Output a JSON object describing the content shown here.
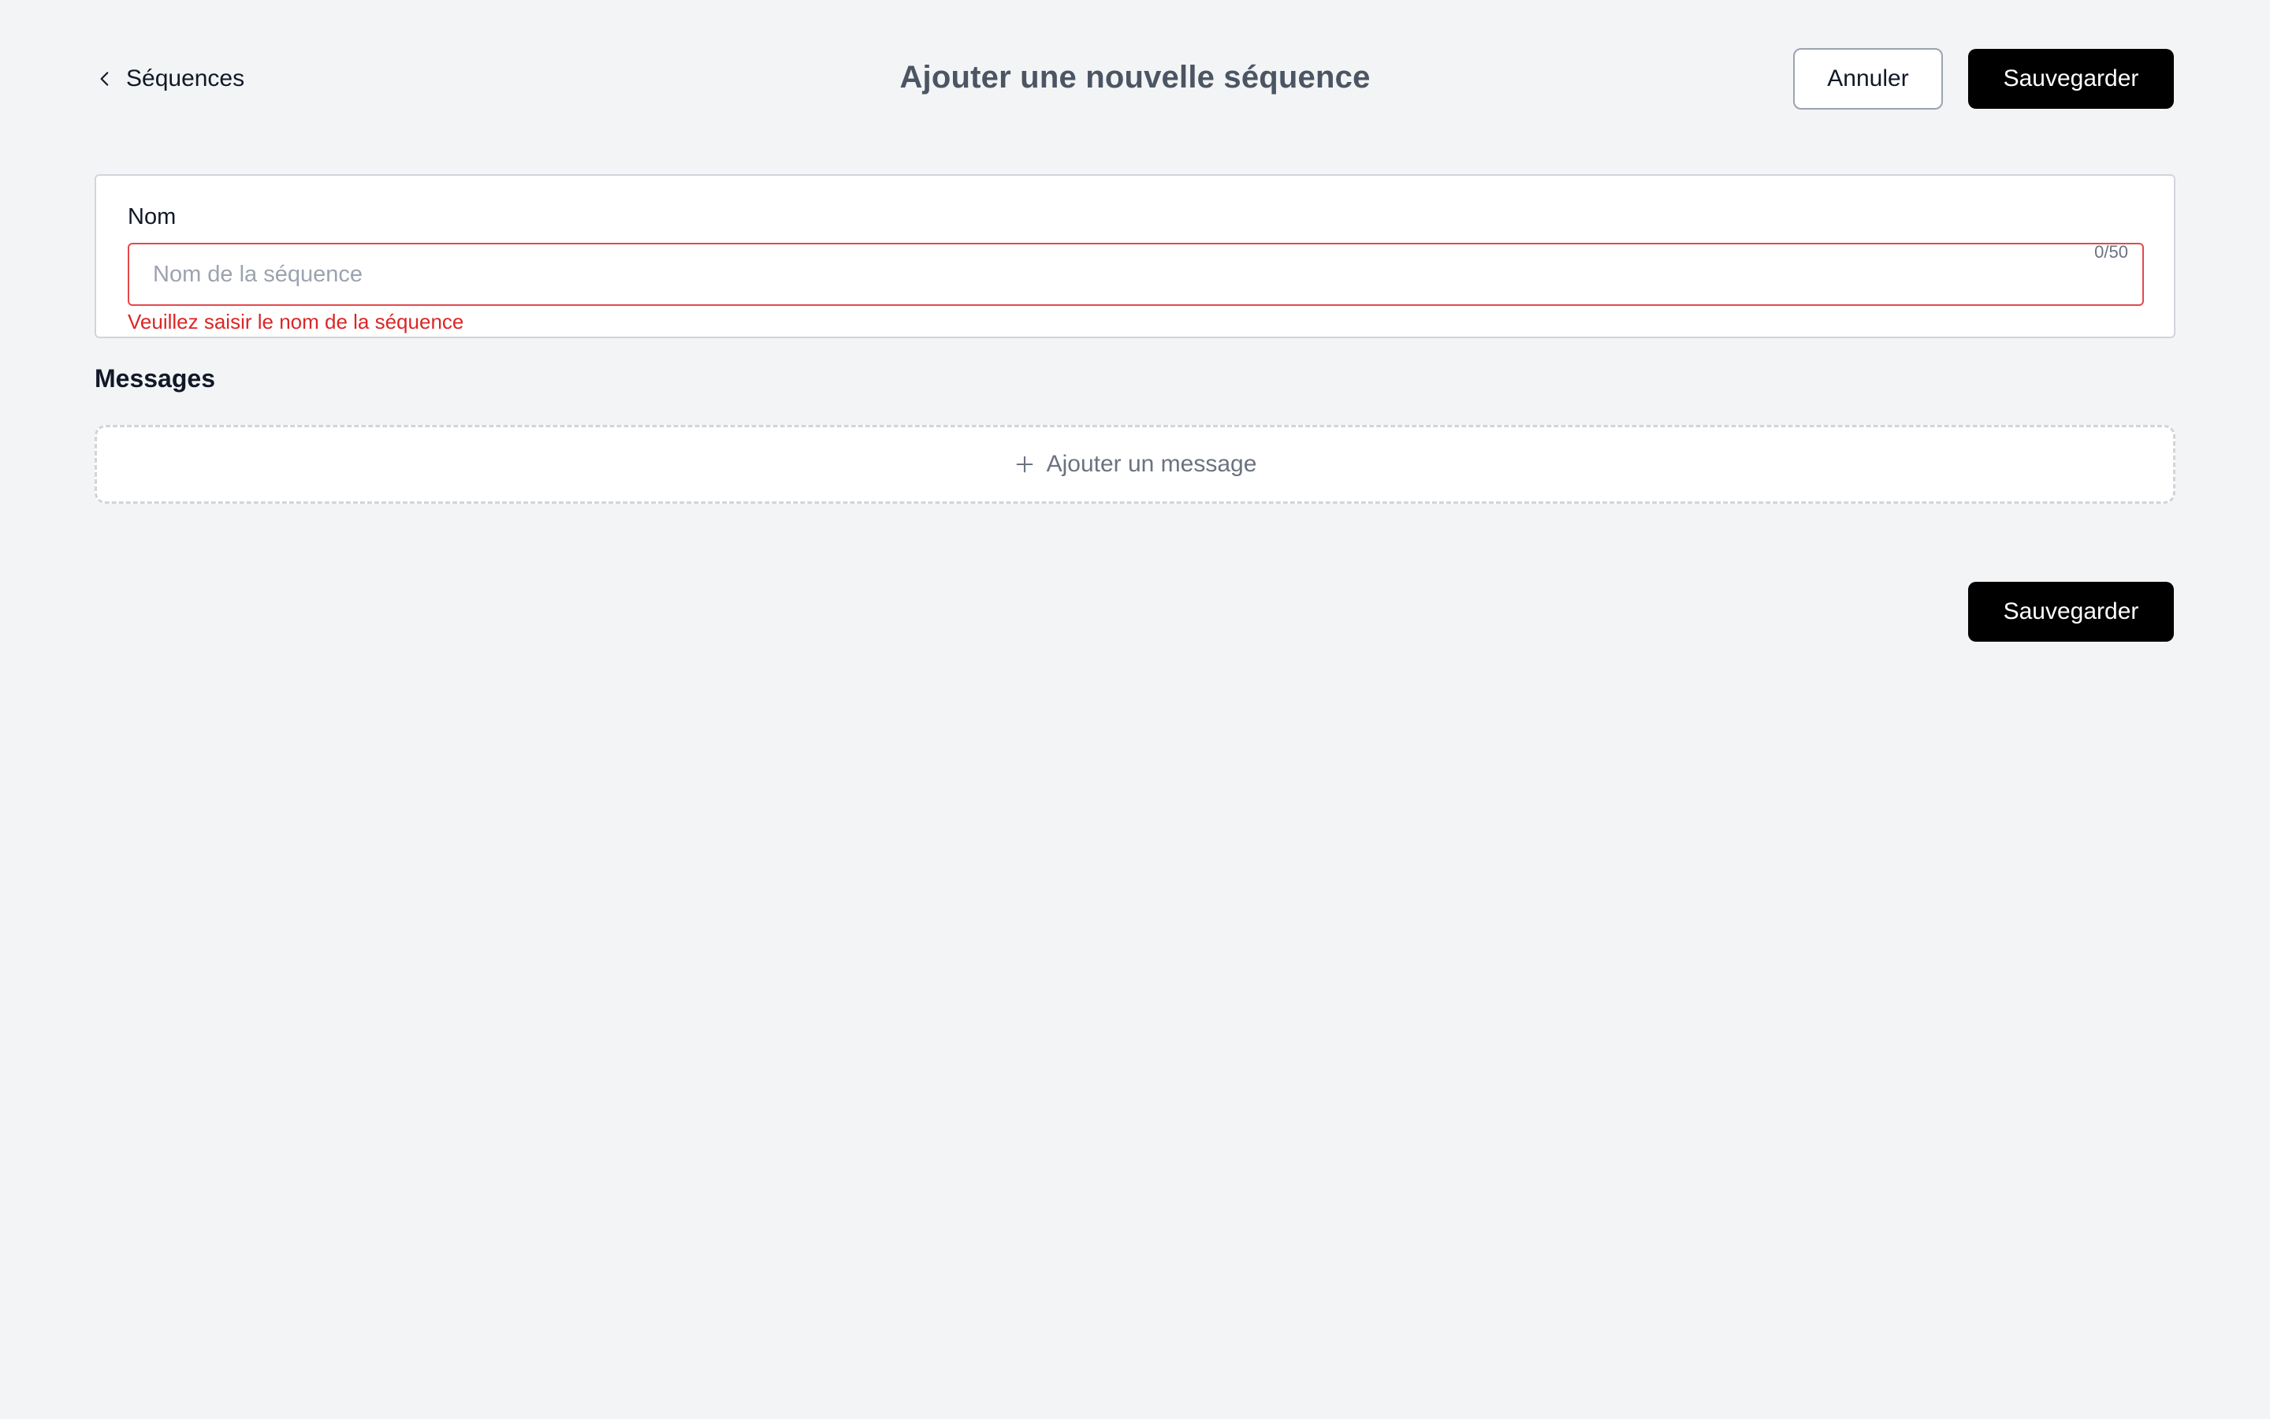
{
  "header": {
    "back_label": "Séquences",
    "title": "Ajouter une nouvelle séquence",
    "cancel_label": "Annuler",
    "save_label": "Sauvegarder"
  },
  "form": {
    "name_label": "Nom",
    "name_value": "",
    "name_placeholder": "Nom de la séquence",
    "char_counter": "0/50",
    "error_message": "Veuillez saisir le nom de la séquence"
  },
  "messages": {
    "section_title": "Messages",
    "add_label": "Ajouter un message"
  },
  "footer": {
    "save_label": "Sauvegarder"
  },
  "colors": {
    "background": "#f3f4f6",
    "primary_button": "#000000",
    "error": "#dc2626",
    "title": "#4b5563"
  },
  "icons": {
    "back": "chevron-left-icon",
    "add": "plus-icon"
  }
}
